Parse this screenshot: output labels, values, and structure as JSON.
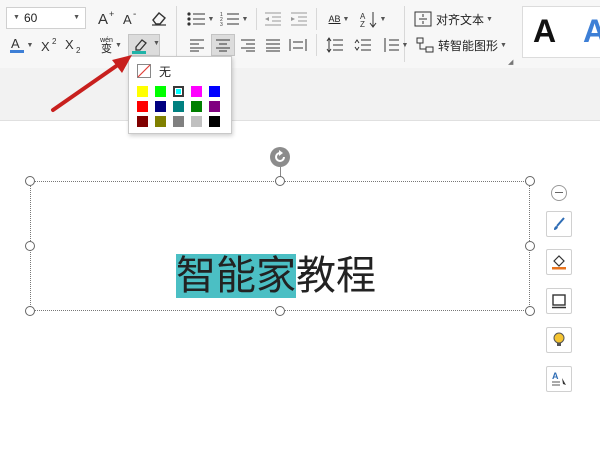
{
  "toolbar": {
    "font_size": "60",
    "style_preview_a": "A",
    "style_preview_b": "A",
    "phonetic_top": "wén",
    "phonetic_bottom": "变",
    "align_text_label": "对齐文本",
    "smart_art_label": "转智能图形",
    "ab_label": "AB"
  },
  "highlight_menu": {
    "none_label": "无",
    "swatches": [
      [
        "#ffff00",
        "#00ff00",
        "#00ffff",
        "#ff00ff",
        "#0000ff"
      ],
      [
        "#ff0000",
        "#000080",
        "#008080",
        "#008000",
        "#800080"
      ],
      [
        "#800000",
        "#808000",
        "#808080",
        "#c0c0c0",
        "#000000"
      ]
    ],
    "selected": "#00ffff"
  },
  "textbox": {
    "highlighted_text": "智能家",
    "plain_text": "教程",
    "highlight_color": "#4bbfc4"
  }
}
